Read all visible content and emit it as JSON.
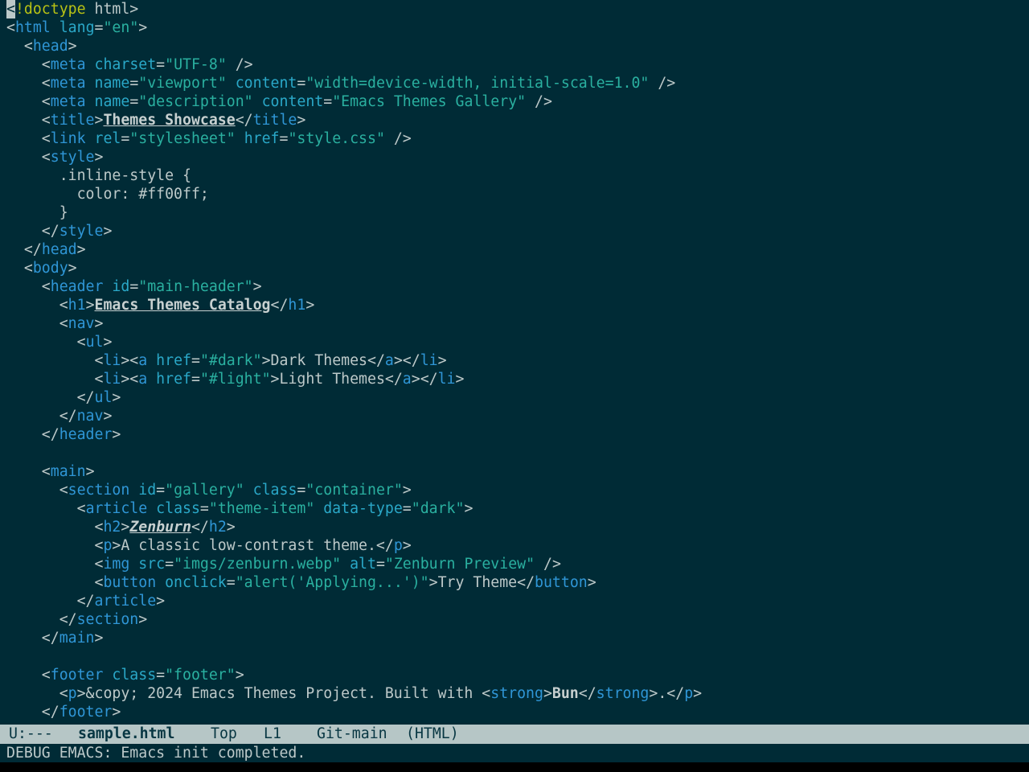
{
  "editor": {
    "lines": [
      [
        {
          "c": "cursor",
          "t": "<"
        },
        {
          "c": "doctype",
          "t": "!doctype"
        },
        {
          "c": "plain",
          "t": " html>"
        }
      ],
      [
        {
          "c": "plain",
          "t": "<"
        },
        {
          "c": "tag",
          "t": "html"
        },
        {
          "c": "plain",
          "t": " "
        },
        {
          "c": "attr",
          "t": "lang"
        },
        {
          "c": "plain",
          "t": "="
        },
        {
          "c": "str",
          "t": "\"en\""
        },
        {
          "c": "plain",
          "t": ">"
        }
      ],
      [
        {
          "c": "plain",
          "t": "  <"
        },
        {
          "c": "tag",
          "t": "head"
        },
        {
          "c": "plain",
          "t": ">"
        }
      ],
      [
        {
          "c": "plain",
          "t": "    <"
        },
        {
          "c": "tag",
          "t": "meta"
        },
        {
          "c": "plain",
          "t": " "
        },
        {
          "c": "attr",
          "t": "charset"
        },
        {
          "c": "plain",
          "t": "="
        },
        {
          "c": "str",
          "t": "\"UTF-8\""
        },
        {
          "c": "plain",
          "t": " />"
        }
      ],
      [
        {
          "c": "plain",
          "t": "    <"
        },
        {
          "c": "tag",
          "t": "meta"
        },
        {
          "c": "plain",
          "t": " "
        },
        {
          "c": "attr",
          "t": "name"
        },
        {
          "c": "plain",
          "t": "="
        },
        {
          "c": "str",
          "t": "\"viewport\""
        },
        {
          "c": "plain",
          "t": " "
        },
        {
          "c": "attr",
          "t": "content"
        },
        {
          "c": "plain",
          "t": "="
        },
        {
          "c": "str",
          "t": "\"width=device-width, initial-scale=1.0\""
        },
        {
          "c": "plain",
          "t": " />"
        }
      ],
      [
        {
          "c": "plain",
          "t": "    <"
        },
        {
          "c": "tag",
          "t": "meta"
        },
        {
          "c": "plain",
          "t": " "
        },
        {
          "c": "attr",
          "t": "name"
        },
        {
          "c": "plain",
          "t": "="
        },
        {
          "c": "str",
          "t": "\"description\""
        },
        {
          "c": "plain",
          "t": " "
        },
        {
          "c": "attr",
          "t": "content"
        },
        {
          "c": "plain",
          "t": "="
        },
        {
          "c": "str",
          "t": "\"Emacs Themes Gallery\""
        },
        {
          "c": "plain",
          "t": " />"
        }
      ],
      [
        {
          "c": "plain",
          "t": "    <"
        },
        {
          "c": "tag",
          "t": "title"
        },
        {
          "c": "plain",
          "t": ">"
        },
        {
          "c": "bold",
          "t": "Themes Showcase"
        },
        {
          "c": "plain",
          "t": "</"
        },
        {
          "c": "tag",
          "t": "title"
        },
        {
          "c": "plain",
          "t": ">"
        }
      ],
      [
        {
          "c": "plain",
          "t": "    <"
        },
        {
          "c": "tag",
          "t": "link"
        },
        {
          "c": "plain",
          "t": " "
        },
        {
          "c": "attr",
          "t": "rel"
        },
        {
          "c": "plain",
          "t": "="
        },
        {
          "c": "str",
          "t": "\"stylesheet\""
        },
        {
          "c": "plain",
          "t": " "
        },
        {
          "c": "attr",
          "t": "href"
        },
        {
          "c": "plain",
          "t": "="
        },
        {
          "c": "str",
          "t": "\"style.css\""
        },
        {
          "c": "plain",
          "t": " />"
        }
      ],
      [
        {
          "c": "plain",
          "t": "    <"
        },
        {
          "c": "tag",
          "t": "style"
        },
        {
          "c": "plain",
          "t": ">"
        }
      ],
      [
        {
          "c": "plain",
          "t": "      .inline-style {"
        }
      ],
      [
        {
          "c": "plain",
          "t": "        color: #ff00ff;"
        }
      ],
      [
        {
          "c": "plain",
          "t": "      }"
        }
      ],
      [
        {
          "c": "plain",
          "t": "    </"
        },
        {
          "c": "tag",
          "t": "style"
        },
        {
          "c": "plain",
          "t": ">"
        }
      ],
      [
        {
          "c": "plain",
          "t": "  </"
        },
        {
          "c": "tag",
          "t": "head"
        },
        {
          "c": "plain",
          "t": ">"
        }
      ],
      [
        {
          "c": "plain",
          "t": "  <"
        },
        {
          "c": "tag",
          "t": "body"
        },
        {
          "c": "plain",
          "t": ">"
        }
      ],
      [
        {
          "c": "plain",
          "t": "    <"
        },
        {
          "c": "tag",
          "t": "header"
        },
        {
          "c": "plain",
          "t": " "
        },
        {
          "c": "attr",
          "t": "id"
        },
        {
          "c": "plain",
          "t": "="
        },
        {
          "c": "str",
          "t": "\"main-header\""
        },
        {
          "c": "plain",
          "t": ">"
        }
      ],
      [
        {
          "c": "plain",
          "t": "      <"
        },
        {
          "c": "tag",
          "t": "h1"
        },
        {
          "c": "plain",
          "t": ">"
        },
        {
          "c": "bold",
          "t": "Emacs Themes Catalog"
        },
        {
          "c": "plain",
          "t": "</"
        },
        {
          "c": "tag",
          "t": "h1"
        },
        {
          "c": "plain",
          "t": ">"
        }
      ],
      [
        {
          "c": "plain",
          "t": "      <"
        },
        {
          "c": "tag",
          "t": "nav"
        },
        {
          "c": "plain",
          "t": ">"
        }
      ],
      [
        {
          "c": "plain",
          "t": "        <"
        },
        {
          "c": "tag",
          "t": "ul"
        },
        {
          "c": "plain",
          "t": ">"
        }
      ],
      [
        {
          "c": "plain",
          "t": "          <"
        },
        {
          "c": "tag",
          "t": "li"
        },
        {
          "c": "plain",
          "t": "><"
        },
        {
          "c": "tag",
          "t": "a"
        },
        {
          "c": "plain",
          "t": " "
        },
        {
          "c": "attr",
          "t": "href"
        },
        {
          "c": "plain",
          "t": "="
        },
        {
          "c": "str",
          "t": "\"#dark\""
        },
        {
          "c": "plain",
          "t": ">Dark Themes</"
        },
        {
          "c": "tag",
          "t": "a"
        },
        {
          "c": "plain",
          "t": "></"
        },
        {
          "c": "tag",
          "t": "li"
        },
        {
          "c": "plain",
          "t": ">"
        }
      ],
      [
        {
          "c": "plain",
          "t": "          <"
        },
        {
          "c": "tag",
          "t": "li"
        },
        {
          "c": "plain",
          "t": "><"
        },
        {
          "c": "tag",
          "t": "a"
        },
        {
          "c": "plain",
          "t": " "
        },
        {
          "c": "attr",
          "t": "href"
        },
        {
          "c": "plain",
          "t": "="
        },
        {
          "c": "str",
          "t": "\"#light\""
        },
        {
          "c": "plain",
          "t": ">Light Themes</"
        },
        {
          "c": "tag",
          "t": "a"
        },
        {
          "c": "plain",
          "t": "></"
        },
        {
          "c": "tag",
          "t": "li"
        },
        {
          "c": "plain",
          "t": ">"
        }
      ],
      [
        {
          "c": "plain",
          "t": "        </"
        },
        {
          "c": "tag",
          "t": "ul"
        },
        {
          "c": "plain",
          "t": ">"
        }
      ],
      [
        {
          "c": "plain",
          "t": "      </"
        },
        {
          "c": "tag",
          "t": "nav"
        },
        {
          "c": "plain",
          "t": ">"
        }
      ],
      [
        {
          "c": "plain",
          "t": "    </"
        },
        {
          "c": "tag",
          "t": "header"
        },
        {
          "c": "plain",
          "t": ">"
        }
      ],
      [],
      [
        {
          "c": "plain",
          "t": "    <"
        },
        {
          "c": "tag",
          "t": "main"
        },
        {
          "c": "plain",
          "t": ">"
        }
      ],
      [
        {
          "c": "plain",
          "t": "      <"
        },
        {
          "c": "tag",
          "t": "section"
        },
        {
          "c": "plain",
          "t": " "
        },
        {
          "c": "attr",
          "t": "id"
        },
        {
          "c": "plain",
          "t": "="
        },
        {
          "c": "str",
          "t": "\"gallery\""
        },
        {
          "c": "plain",
          "t": " "
        },
        {
          "c": "attr",
          "t": "class"
        },
        {
          "c": "plain",
          "t": "="
        },
        {
          "c": "str",
          "t": "\"container\""
        },
        {
          "c": "plain",
          "t": ">"
        }
      ],
      [
        {
          "c": "plain",
          "t": "        <"
        },
        {
          "c": "tag",
          "t": "article"
        },
        {
          "c": "plain",
          "t": " "
        },
        {
          "c": "attr",
          "t": "class"
        },
        {
          "c": "plain",
          "t": "="
        },
        {
          "c": "str",
          "t": "\"theme-item\""
        },
        {
          "c": "plain",
          "t": " "
        },
        {
          "c": "attr",
          "t": "data-type"
        },
        {
          "c": "plain",
          "t": "="
        },
        {
          "c": "str",
          "t": "\"dark\""
        },
        {
          "c": "plain",
          "t": ">"
        }
      ],
      [
        {
          "c": "plain",
          "t": "          <"
        },
        {
          "c": "tag",
          "t": "h2"
        },
        {
          "c": "plain",
          "t": ">"
        },
        {
          "c": "bolditalic",
          "t": "Zenburn"
        },
        {
          "c": "plain",
          "t": "</"
        },
        {
          "c": "tag",
          "t": "h2"
        },
        {
          "c": "plain",
          "t": ">"
        }
      ],
      [
        {
          "c": "plain",
          "t": "          <"
        },
        {
          "c": "tag",
          "t": "p"
        },
        {
          "c": "plain",
          "t": ">A classic low-contrast theme.</"
        },
        {
          "c": "tag",
          "t": "p"
        },
        {
          "c": "plain",
          "t": ">"
        }
      ],
      [
        {
          "c": "plain",
          "t": "          <"
        },
        {
          "c": "tag",
          "t": "img"
        },
        {
          "c": "plain",
          "t": " "
        },
        {
          "c": "attr",
          "t": "src"
        },
        {
          "c": "plain",
          "t": "="
        },
        {
          "c": "str",
          "t": "\"imgs/zenburn.webp\""
        },
        {
          "c": "plain",
          "t": " "
        },
        {
          "c": "attr",
          "t": "alt"
        },
        {
          "c": "plain",
          "t": "="
        },
        {
          "c": "str",
          "t": "\"Zenburn Preview\""
        },
        {
          "c": "plain",
          "t": " />"
        }
      ],
      [
        {
          "c": "plain",
          "t": "          <"
        },
        {
          "c": "tag",
          "t": "button"
        },
        {
          "c": "plain",
          "t": " "
        },
        {
          "c": "attr",
          "t": "onclick"
        },
        {
          "c": "plain",
          "t": "="
        },
        {
          "c": "str",
          "t": "\"alert('Applying...')\""
        },
        {
          "c": "plain",
          "t": ">Try Theme</"
        },
        {
          "c": "tag",
          "t": "button"
        },
        {
          "c": "plain",
          "t": ">"
        }
      ],
      [
        {
          "c": "plain",
          "t": "        </"
        },
        {
          "c": "tag",
          "t": "article"
        },
        {
          "c": "plain",
          "t": ">"
        }
      ],
      [
        {
          "c": "plain",
          "t": "      </"
        },
        {
          "c": "tag",
          "t": "section"
        },
        {
          "c": "plain",
          "t": ">"
        }
      ],
      [
        {
          "c": "plain",
          "t": "    </"
        },
        {
          "c": "tag",
          "t": "main"
        },
        {
          "c": "plain",
          "t": ">"
        }
      ],
      [],
      [
        {
          "c": "plain",
          "t": "    <"
        },
        {
          "c": "tag",
          "t": "footer"
        },
        {
          "c": "plain",
          "t": " "
        },
        {
          "c": "attr",
          "t": "class"
        },
        {
          "c": "plain",
          "t": "="
        },
        {
          "c": "str",
          "t": "\"footer\""
        },
        {
          "c": "plain",
          "t": ">"
        }
      ],
      [
        {
          "c": "plain",
          "t": "      <"
        },
        {
          "c": "tag",
          "t": "p"
        },
        {
          "c": "plain",
          "t": ">&copy; 2024 Emacs Themes Project. Built with <"
        },
        {
          "c": "tag",
          "t": "strong"
        },
        {
          "c": "plain",
          "t": ">"
        },
        {
          "c": "strong",
          "t": "Bun"
        },
        {
          "c": "plain",
          "t": "</"
        },
        {
          "c": "tag",
          "t": "strong"
        },
        {
          "c": "plain",
          "t": ">.</"
        },
        {
          "c": "tag",
          "t": "p"
        },
        {
          "c": "plain",
          "t": ">"
        }
      ],
      [
        {
          "c": "plain",
          "t": "    </"
        },
        {
          "c": "tag",
          "t": "footer"
        },
        {
          "c": "plain",
          "t": ">"
        }
      ]
    ]
  },
  "modeline": {
    "state": "U:---",
    "filename": "sample.html",
    "position": "Top",
    "line": "L1",
    "vc": "Git-main",
    "mode": "(HTML)"
  },
  "minibuffer": {
    "message": "DEBUG EMACS: Emacs init completed."
  },
  "colors": {
    "background": "#002b36",
    "foreground": "#bdc9c9",
    "tag": "#2f96d6",
    "attribute": "#2aa8c8",
    "string": "#2ab0a0",
    "doctype": "#b8c214",
    "modeline_bg": "#b6c6c6",
    "modeline_fg": "#073642"
  }
}
